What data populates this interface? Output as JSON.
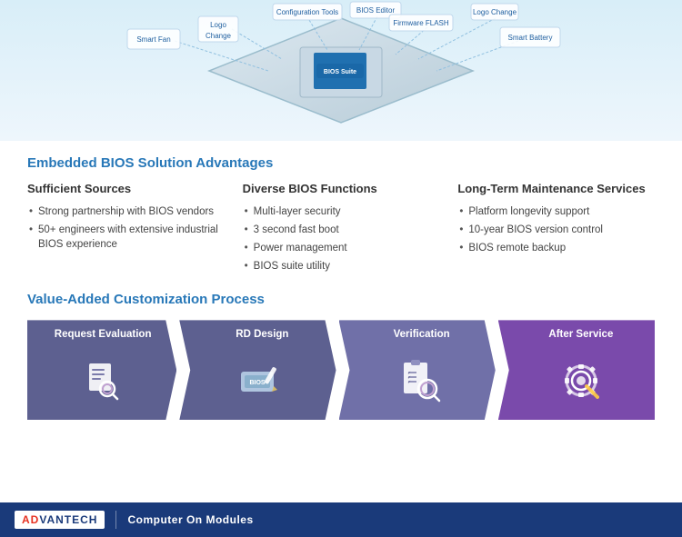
{
  "header": {
    "labels": {
      "smart_fan": "Smart Fan",
      "logo_change_left": "Logo\nChange",
      "config_tools": "Configuration Tools",
      "bios_editor": "BIOS Editor",
      "firmware_flash": "Firmware FLASH",
      "logo_change_right": "Logo Change",
      "smart_battery": "Smart Battery",
      "bios_suite": "BIOS Suite"
    }
  },
  "advantages": {
    "section_title": "Embedded BIOS Solution Advantages",
    "cols": [
      {
        "title": "Sufficient Sources",
        "items": [
          "Strong partnership with BIOS vendors",
          "50+ engineers with extensive industrial BIOS experience"
        ]
      },
      {
        "title": "Diverse BIOS Functions",
        "items": [
          "Multi-layer security",
          "3 second fast boot",
          "Power management",
          "BIOS suite utility"
        ]
      },
      {
        "title": "Long-Term Maintenance Services",
        "items": [
          "Platform longevity support",
          "10-year BIOS version control",
          "BIOS remote backup"
        ]
      }
    ]
  },
  "value_added": {
    "section_title": "Value-Added Customization Process",
    "steps": [
      {
        "label": "Request Evaluation"
      },
      {
        "label": "RD Design"
      },
      {
        "label": "Verification"
      },
      {
        "label": "After Service"
      }
    ]
  },
  "footer": {
    "brand_ad": "AD",
    "brand_vantech": "VANTECH",
    "product_line": "Computer On Modules"
  }
}
